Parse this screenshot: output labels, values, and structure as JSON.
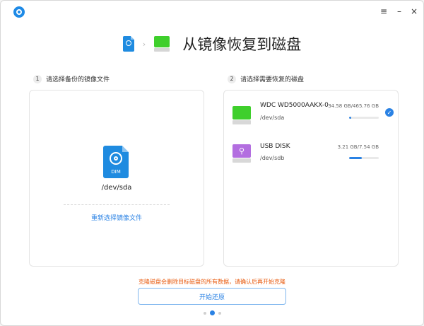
{
  "window": {
    "title": "从镜像恢复到磁盘",
    "controls": {
      "menu": "≡",
      "minimize": "–",
      "close": "×"
    }
  },
  "header": {
    "source_icon_label": "DIM",
    "arrow": "›"
  },
  "steps": {
    "step1": {
      "num": "1",
      "label": "请选择备份的镜像文件"
    },
    "step2": {
      "num": "2",
      "label": "请选择需要恢复的磁盘"
    }
  },
  "image_panel": {
    "icon_label": "DIM",
    "path": "/dev/sda",
    "reselect_label": "重新选择镜像文件"
  },
  "disks": [
    {
      "name": "WDC WD5000AAKX-0",
      "device": "/dev/sda",
      "usage": "34.58 GB/465.76 GB",
      "fill": 0.074,
      "icon": "hard-disk-icon",
      "color": "#3fcf2c",
      "selected": true
    },
    {
      "name": "USB DISK",
      "device": "/dev/sdb",
      "usage": "3.21 GB/7.54 GB",
      "fill": 0.426,
      "icon": "usb-disk-icon",
      "color": "#b36ee0",
      "selected": false
    }
  ],
  "warning": "克隆磁盘会删除目标磁盘的所有数据，请确认后再开始克隆",
  "start_button": "开始还原",
  "pagination": {
    "pages": 3,
    "current": 1
  },
  "colors": {
    "accent": "#2a82e4",
    "warning": "#e8590c",
    "disk_green": "#3fcf2c",
    "usb_purple": "#b36ee0"
  }
}
